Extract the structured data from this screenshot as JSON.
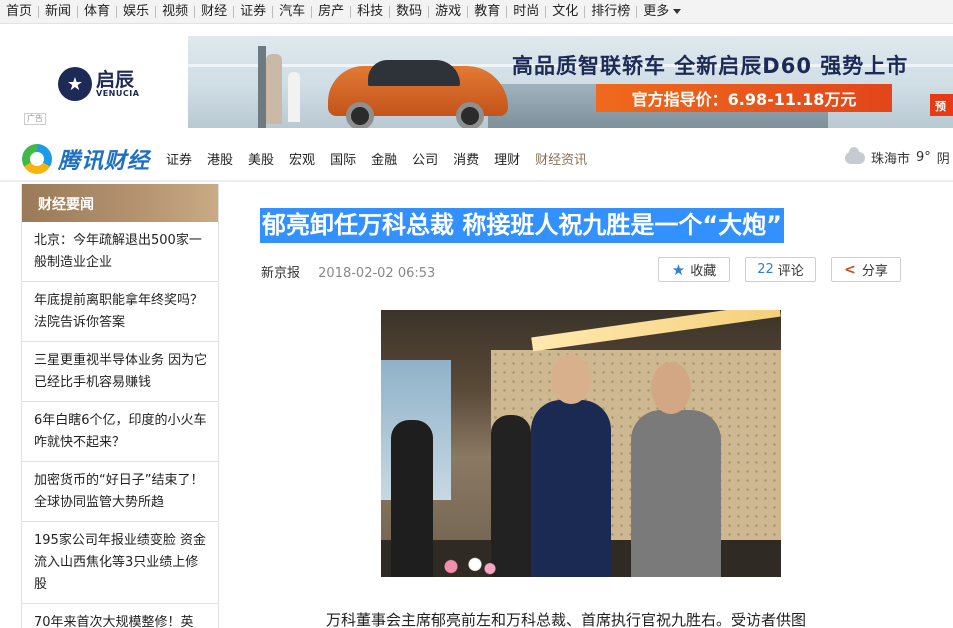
{
  "topnav": {
    "items": [
      "首页",
      "新闻",
      "体育",
      "娱乐",
      "视频",
      "财经",
      "证券",
      "汽车",
      "房产",
      "科技",
      "数码",
      "游戏",
      "教育",
      "时尚",
      "文化",
      "排行榜"
    ],
    "more_label": "更多"
  },
  "ad": {
    "logo_cn": "启辰",
    "logo_en": "VENUCIA",
    "ad_tag": "广告",
    "slogan": "高品质智联轿车 全新启辰D60 强势上市",
    "price": "官方指导价：6.98-11.18万元",
    "corner_text": "预"
  },
  "channel": {
    "brand": "腾讯财经",
    "links": [
      "证券",
      "港股",
      "美股",
      "宏观",
      "国际",
      "金融",
      "公司",
      "消费",
      "理财",
      "财经资讯"
    ],
    "weather_city": "珠海市",
    "weather_temp": "9°",
    "weather_desc": "阴"
  },
  "sidebar": {
    "title": "财经要闻",
    "items": [
      "北京：今年疏解退出500家一般制造业企业",
      "年底提前离职能拿年终奖吗？法院告诉你答案",
      "三星更重视半导体业务 因为它已经比手机容易赚钱",
      "6年白瞎6个亿，印度的小火车咋就快不起来？",
      "加密货币的“好日子”结束了！全球协同监管大势所趋",
      "195家公司年报业绩变脸 资金流入山西焦化等3只业绩上修股",
      "70年来首次大规模整修！英"
    ]
  },
  "article": {
    "title": "郁亮卸任万科总裁 称接班人祝九胜是一个“大炮”",
    "source": "新京报",
    "datetime": "2018-02-02 06:53",
    "fav_label": "收藏",
    "comment_count": "22",
    "comment_label": "评论",
    "share_label": "分享",
    "caption": "万科董事会主席郁亮前左和万科总裁、首席执行官祝九胜右。受访者供图"
  },
  "colors": {
    "selection": "#3390ff",
    "sidebar_head": "#9a7a58",
    "brand_blue": "#1f6fc5"
  }
}
